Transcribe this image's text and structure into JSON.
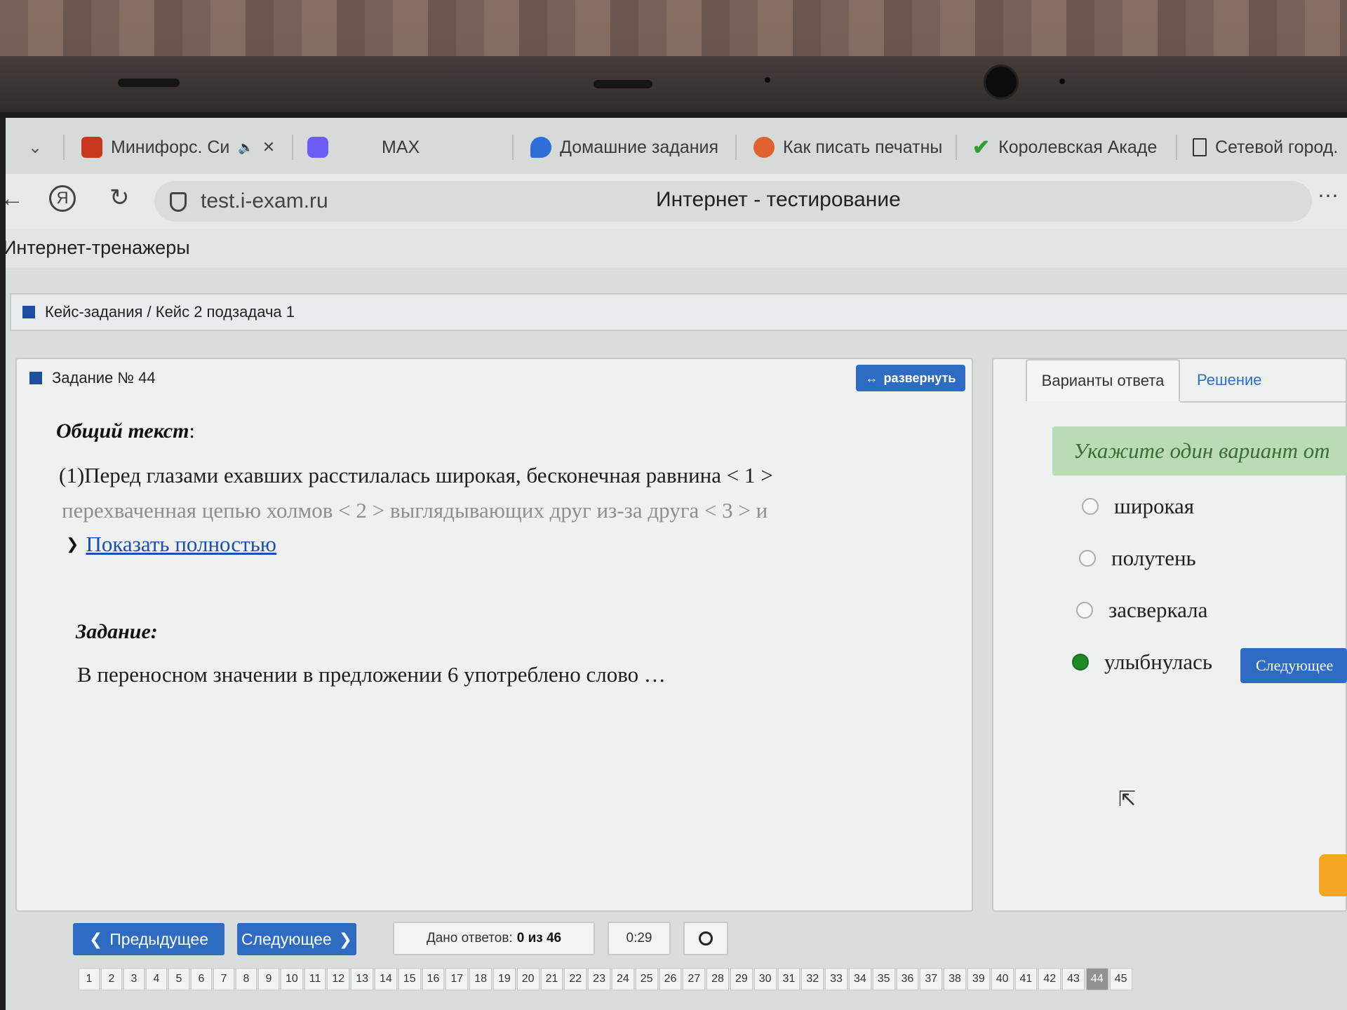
{
  "browser": {
    "tabs": [
      {
        "title": "Минифорс. Си",
        "icon": "k-logo-icon",
        "color": "#c8381e"
      },
      {
        "title": "",
        "icon": "circle-app-icon",
        "color": "#6a5cf4"
      },
      {
        "title": "MAX",
        "icon": "",
        "color": ""
      },
      {
        "title": "Домашние задания",
        "icon": "pencil-cloud-icon",
        "color": "#2f6ed8"
      },
      {
        "title": "Как писать печатны",
        "icon": "avatar-icon",
        "color": "#e06030"
      },
      {
        "title": "Королевская Акаде",
        "icon": "check-icon",
        "color": "#2e9e2e"
      },
      {
        "title": "Сетевой город.",
        "icon": "document-icon",
        "color": "#444"
      }
    ],
    "url": "test.i-exam.ru",
    "page_title": "Интернет - тестирование",
    "more": "⋯"
  },
  "app": {
    "title": "Интернет-тренажеры",
    "breadcrumb": "Кейс-задания / Кейс 2 подзадача 1"
  },
  "task": {
    "title": "Задание № 44",
    "expand_label": "развернуть",
    "general_label": "Общий текст",
    "general_colon": ":",
    "text_line1": "(1)Перед глазами ехавших расстилалась широкая, бесконечная равнина < 1 >",
    "text_line2": "перехваченная цепью холмов < 2 > выглядывающих друг из-за друга < 3 > и",
    "show_more": "Показать полностью",
    "task_label": "Задание:",
    "task_text": "В переносном значении в предложении 6 употреблено слово …"
  },
  "answers": {
    "tab_variants": "Варианты ответа",
    "tab_solution": "Решение",
    "hint": "Укажите один вариант от",
    "options": [
      {
        "label": "широкая",
        "selected": false
      },
      {
        "label": "полутень",
        "selected": false
      },
      {
        "label": "засверкала",
        "selected": false
      },
      {
        "label": "улыбнулась",
        "selected": true
      }
    ],
    "next_label": "Следующее"
  },
  "footer": {
    "prev_label": "Предыдущее",
    "next_label": "Следующее",
    "answers_given_label": "Дано ответов:",
    "answers_given_value": "0 из 46",
    "timer": "0:29",
    "pages": [
      "1",
      "2",
      "3",
      "4",
      "5",
      "6",
      "7",
      "8",
      "9",
      "10",
      "11",
      "12",
      "13",
      "14",
      "15",
      "16",
      "17",
      "18",
      "19",
      "20",
      "21",
      "22",
      "23",
      "24",
      "25",
      "26",
      "27",
      "28",
      "29",
      "30",
      "31",
      "32",
      "33",
      "34",
      "35",
      "36",
      "37",
      "38",
      "39",
      "40",
      "41",
      "42",
      "43",
      "44",
      "45"
    ],
    "current_page": "44"
  }
}
